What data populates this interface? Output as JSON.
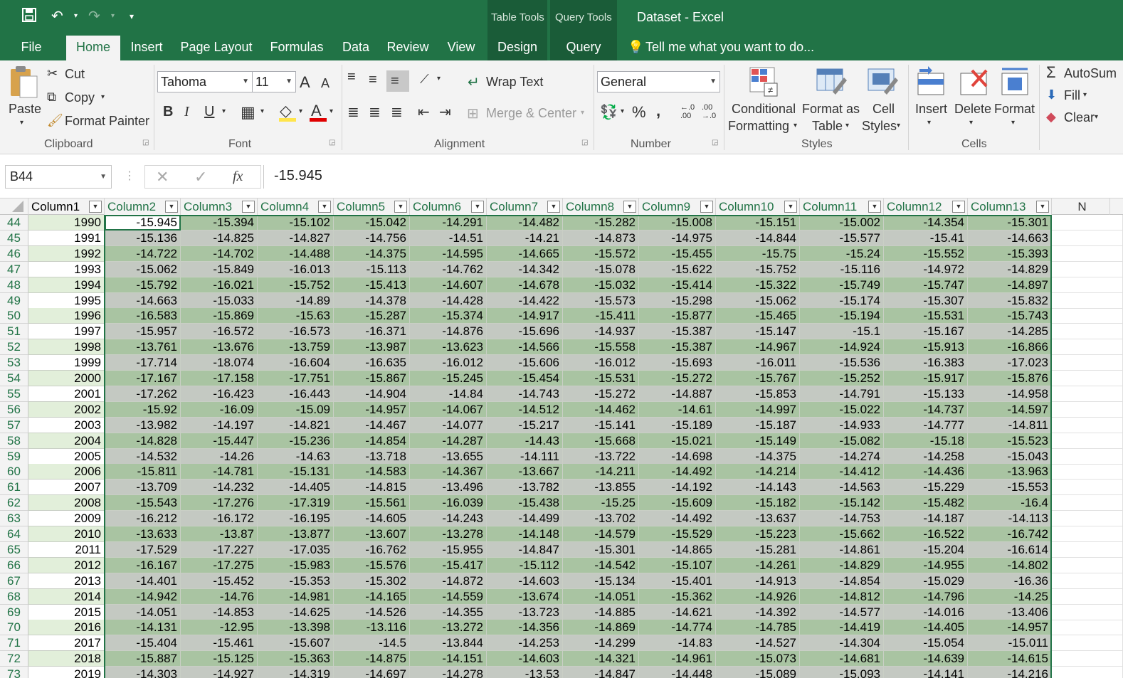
{
  "titlebar": {
    "context_tab_1": "Table Tools",
    "context_tab_2": "Query Tools",
    "title": "Dataset - Excel"
  },
  "tabs": [
    "File",
    "Home",
    "Insert",
    "Page Layout",
    "Formulas",
    "Data",
    "Review",
    "View",
    "Design",
    "Query"
  ],
  "tell_me": "Tell me what you want to do...",
  "clipboard": {
    "paste": "Paste",
    "cut": "Cut",
    "copy": "Copy",
    "format_painter": "Format Painter",
    "label": "Clipboard"
  },
  "font": {
    "name": "Tahoma",
    "size": "11",
    "label": "Font",
    "bold": "B",
    "italic": "I",
    "underline": "U",
    "font_color": "A",
    "grow": "A",
    "shrink": "A"
  },
  "alignment": {
    "wrap_text": "Wrap Text",
    "merge_center": "Merge & Center",
    "label": "Alignment"
  },
  "number": {
    "format": "General",
    "label": "Number",
    "percent": "%",
    "comma": ",",
    "inc_decimal": "←.0 .00",
    "dec_decimal": ".00 →.0"
  },
  "styles": {
    "conditional": "Conditional",
    "formatting": "Formatting",
    "format_as": "Format as",
    "table": "Table",
    "cell": "Cell",
    "styles": "Styles",
    "label": "Styles"
  },
  "cells": {
    "insert": "Insert",
    "delete": "Delete",
    "format": "Format",
    "label": "Cells"
  },
  "editing": {
    "autosum": "AutoSum",
    "fill": "Fill",
    "clear": "Clear"
  },
  "formula_bar": {
    "name_box": "B44",
    "value": "-15.945",
    "fx": "fx"
  },
  "columns": [
    "Column1",
    "Column2",
    "Column3",
    "Column4",
    "Column5",
    "Column6",
    "Column7",
    "Column8",
    "Column9",
    "Column10",
    "Column11",
    "Column12",
    "Column13"
  ],
  "next_col": "N",
  "rows": [
    {
      "n": "44",
      "v": [
        "1990",
        "-15.945",
        "-15.394",
        "-15.102",
        "-15.042",
        "-14.291",
        "-14.482",
        "-15.282",
        "-15.008",
        "-15.151",
        "-15.002",
        "-14.354",
        "-15.301"
      ]
    },
    {
      "n": "45",
      "v": [
        "1991",
        "-15.136",
        "-14.825",
        "-14.827",
        "-14.756",
        "-14.51",
        "-14.21",
        "-14.873",
        "-14.975",
        "-14.844",
        "-15.577",
        "-15.41",
        "-14.663"
      ]
    },
    {
      "n": "46",
      "v": [
        "1992",
        "-14.722",
        "-14.702",
        "-14.488",
        "-14.375",
        "-14.595",
        "-14.665",
        "-15.572",
        "-15.455",
        "-15.75",
        "-15.24",
        "-15.552",
        "-15.393"
      ]
    },
    {
      "n": "47",
      "v": [
        "1993",
        "-15.062",
        "-15.849",
        "-16.013",
        "-15.113",
        "-14.762",
        "-14.342",
        "-15.078",
        "-15.622",
        "-15.752",
        "-15.116",
        "-14.972",
        "-14.829"
      ]
    },
    {
      "n": "48",
      "v": [
        "1994",
        "-15.792",
        "-16.021",
        "-15.752",
        "-15.413",
        "-14.607",
        "-14.678",
        "-15.032",
        "-15.414",
        "-15.322",
        "-15.749",
        "-15.747",
        "-14.897"
      ]
    },
    {
      "n": "49",
      "v": [
        "1995",
        "-14.663",
        "-15.033",
        "-14.89",
        "-14.378",
        "-14.428",
        "-14.422",
        "-15.573",
        "-15.298",
        "-15.062",
        "-15.174",
        "-15.307",
        "-15.832"
      ]
    },
    {
      "n": "50",
      "v": [
        "1996",
        "-16.583",
        "-15.869",
        "-15.63",
        "-15.287",
        "-15.374",
        "-14.917",
        "-15.411",
        "-15.877",
        "-15.465",
        "-15.194",
        "-15.531",
        "-15.743"
      ]
    },
    {
      "n": "51",
      "v": [
        "1997",
        "-15.957",
        "-16.572",
        "-16.573",
        "-16.371",
        "-14.876",
        "-15.696",
        "-14.937",
        "-15.387",
        "-15.147",
        "-15.1",
        "-15.167",
        "-14.285"
      ]
    },
    {
      "n": "52",
      "v": [
        "1998",
        "-13.761",
        "-13.676",
        "-13.759",
        "-13.987",
        "-13.623",
        "-14.566",
        "-15.558",
        "-15.387",
        "-14.967",
        "-14.924",
        "-15.913",
        "-16.866"
      ]
    },
    {
      "n": "53",
      "v": [
        "1999",
        "-17.714",
        "-18.074",
        "-16.604",
        "-16.635",
        "-16.012",
        "-15.606",
        "-16.012",
        "-15.693",
        "-16.011",
        "-15.536",
        "-16.383",
        "-17.023"
      ]
    },
    {
      "n": "54",
      "v": [
        "2000",
        "-17.167",
        "-17.158",
        "-17.751",
        "-15.867",
        "-15.245",
        "-15.454",
        "-15.531",
        "-15.272",
        "-15.767",
        "-15.252",
        "-15.917",
        "-15.876"
      ]
    },
    {
      "n": "55",
      "v": [
        "2001",
        "-17.262",
        "-16.423",
        "-16.443",
        "-14.904",
        "-14.84",
        "-14.743",
        "-15.272",
        "-14.887",
        "-15.853",
        "-14.791",
        "-15.133",
        "-14.958"
      ]
    },
    {
      "n": "56",
      "v": [
        "2002",
        "-15.92",
        "-16.09",
        "-15.09",
        "-14.957",
        "-14.067",
        "-14.512",
        "-14.462",
        "-14.61",
        "-14.997",
        "-15.022",
        "-14.737",
        "-14.597"
      ]
    },
    {
      "n": "57",
      "v": [
        "2003",
        "-13.982",
        "-14.197",
        "-14.821",
        "-14.467",
        "-14.077",
        "-15.217",
        "-15.141",
        "-15.189",
        "-15.187",
        "-14.933",
        "-14.777",
        "-14.811"
      ]
    },
    {
      "n": "58",
      "v": [
        "2004",
        "-14.828",
        "-15.447",
        "-15.236",
        "-14.854",
        "-14.287",
        "-14.43",
        "-15.668",
        "-15.021",
        "-15.149",
        "-15.082",
        "-15.18",
        "-15.523"
      ]
    },
    {
      "n": "59",
      "v": [
        "2005",
        "-14.532",
        "-14.26",
        "-14.63",
        "-13.718",
        "-13.655",
        "-14.111",
        "-13.722",
        "-14.698",
        "-14.375",
        "-14.274",
        "-14.258",
        "-15.043"
      ]
    },
    {
      "n": "60",
      "v": [
        "2006",
        "-15.811",
        "-14.781",
        "-15.131",
        "-14.583",
        "-14.367",
        "-13.667",
        "-14.211",
        "-14.492",
        "-14.214",
        "-14.412",
        "-14.436",
        "-13.963"
      ]
    },
    {
      "n": "61",
      "v": [
        "2007",
        "-13.709",
        "-14.232",
        "-14.405",
        "-14.815",
        "-13.496",
        "-13.782",
        "-13.855",
        "-14.192",
        "-14.143",
        "-14.563",
        "-15.229",
        "-15.553"
      ]
    },
    {
      "n": "62",
      "v": [
        "2008",
        "-15.543",
        "-17.276",
        "-17.319",
        "-15.561",
        "-16.039",
        "-15.438",
        "-15.25",
        "-15.609",
        "-15.182",
        "-15.142",
        "-15.482",
        "-16.4"
      ]
    },
    {
      "n": "63",
      "v": [
        "2009",
        "-16.212",
        "-16.172",
        "-16.195",
        "-14.605",
        "-14.243",
        "-14.499",
        "-13.702",
        "-14.492",
        "-13.637",
        "-14.753",
        "-14.187",
        "-14.113"
      ]
    },
    {
      "n": "64",
      "v": [
        "2010",
        "-13.633",
        "-13.87",
        "-13.877",
        "-13.607",
        "-13.278",
        "-14.148",
        "-14.579",
        "-15.529",
        "-15.223",
        "-15.662",
        "-16.522",
        "-16.742"
      ]
    },
    {
      "n": "65",
      "v": [
        "2011",
        "-17.529",
        "-17.227",
        "-17.035",
        "-16.762",
        "-15.955",
        "-14.847",
        "-15.301",
        "-14.865",
        "-15.281",
        "-14.861",
        "-15.204",
        "-16.614"
      ]
    },
    {
      "n": "66",
      "v": [
        "2012",
        "-16.167",
        "-17.275",
        "-15.983",
        "-15.576",
        "-15.417",
        "-15.112",
        "-14.542",
        "-15.107",
        "-14.261",
        "-14.829",
        "-14.955",
        "-14.802"
      ]
    },
    {
      "n": "67",
      "v": [
        "2013",
        "-14.401",
        "-15.452",
        "-15.353",
        "-15.302",
        "-14.872",
        "-14.603",
        "-15.134",
        "-15.401",
        "-14.913",
        "-14.854",
        "-15.029",
        "-16.36"
      ]
    },
    {
      "n": "68",
      "v": [
        "2014",
        "-14.942",
        "-14.76",
        "-14.981",
        "-14.165",
        "-14.559",
        "-13.674",
        "-14.051",
        "-15.362",
        "-14.926",
        "-14.812",
        "-14.796",
        "-14.25"
      ]
    },
    {
      "n": "69",
      "v": [
        "2015",
        "-14.051",
        "-14.853",
        "-14.625",
        "-14.526",
        "-14.355",
        "-13.723",
        "-14.885",
        "-14.621",
        "-14.392",
        "-14.577",
        "-14.016",
        "-13.406"
      ]
    },
    {
      "n": "70",
      "v": [
        "2016",
        "-14.131",
        "-12.95",
        "-13.398",
        "-13.116",
        "-13.272",
        "-14.356",
        "-14.869",
        "-14.774",
        "-14.785",
        "-14.419",
        "-14.405",
        "-14.957"
      ]
    },
    {
      "n": "71",
      "v": [
        "2017",
        "-15.404",
        "-15.461",
        "-15.607",
        "-14.5",
        "-13.844",
        "-14.253",
        "-14.299",
        "-14.83",
        "-14.527",
        "-14.304",
        "-15.054",
        "-15.011"
      ]
    },
    {
      "n": "72",
      "v": [
        "2018",
        "-15.887",
        "-15.125",
        "-15.363",
        "-14.875",
        "-14.151",
        "-14.603",
        "-14.321",
        "-14.961",
        "-15.073",
        "-14.681",
        "-14.639",
        "-14.615"
      ]
    },
    {
      "n": "73",
      "v": [
        "2019",
        "-14.303",
        "-14.927",
        "-14.319",
        "-14.697",
        "-14.278",
        "-13.53",
        "-14.847",
        "-14.448",
        "-15.089",
        "-15.093",
        "-14.141",
        "-14.216"
      ]
    }
  ]
}
